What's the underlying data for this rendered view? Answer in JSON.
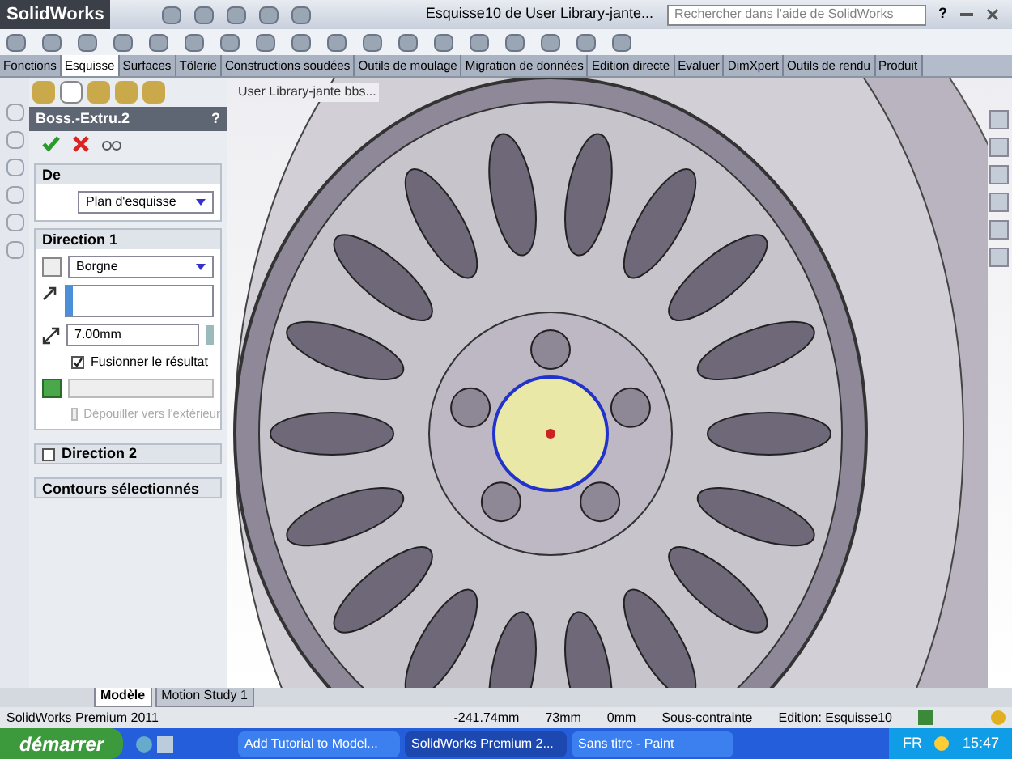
{
  "app": {
    "logo": "SolidWorks",
    "document_title": "Esquisse10 de User Library-jante...",
    "help_search": {
      "placeholder": "Rechercher dans l'aide de SolidWorks"
    },
    "help_glyph": "?"
  },
  "tabs": [
    {
      "label": "Fonctions",
      "selected": false
    },
    {
      "label": "Esquisse",
      "selected": true
    },
    {
      "label": "Surfaces",
      "selected": false
    },
    {
      "label": "Tôlerie",
      "selected": false
    },
    {
      "label": "Constructions soudées",
      "selected": false
    },
    {
      "label": "Outils de moulage",
      "selected": false
    },
    {
      "label": "Migration de données",
      "selected": false
    },
    {
      "label": "Edition directe",
      "selected": false
    },
    {
      "label": "Evaluer",
      "selected": false
    },
    {
      "label": "DimXpert",
      "selected": false
    },
    {
      "label": "Outils de rendu",
      "selected": false
    },
    {
      "label": "Produit",
      "selected": false
    }
  ],
  "property_manager": {
    "title": "Boss.-Extru.2",
    "help": "?",
    "from": {
      "title": "De",
      "value": "Plan d'esquisse"
    },
    "direction1": {
      "title": "Direction 1",
      "end_condition": "Borgne",
      "depth": "7.00mm",
      "merge": {
        "label": "Fusionner le résultat",
        "checked": true
      },
      "draft_outward": {
        "label": "Dépouiller vers l'extérieur",
        "checked": false,
        "disabled": true
      }
    },
    "direction2": {
      "title": "Direction 2",
      "checked": false
    },
    "contours": {
      "title": "Contours sélectionnés"
    }
  },
  "viewport": {
    "breadcrumb": "User Library-jante bbs..."
  },
  "model_tabs": [
    {
      "label": "Modèle",
      "selected": true
    },
    {
      "label": "Motion Study 1",
      "selected": false
    }
  ],
  "status_bar": {
    "app": "SolidWorks Premium 2011",
    "x": "-241.74mm",
    "y": "73mm",
    "z": "0mm",
    "state": "Sous-contrainte",
    "edit": "Edition: Esquisse10"
  },
  "taskbar": {
    "start": "démarrer",
    "items": [
      {
        "label": "Add Tutorial to Model...",
        "selected": false
      },
      {
        "label": "SolidWorks Premium 2...",
        "selected": true
      },
      {
        "label": "Sans titre - Paint",
        "selected": false
      }
    ],
    "lang": "FR",
    "clock": "15:47"
  }
}
